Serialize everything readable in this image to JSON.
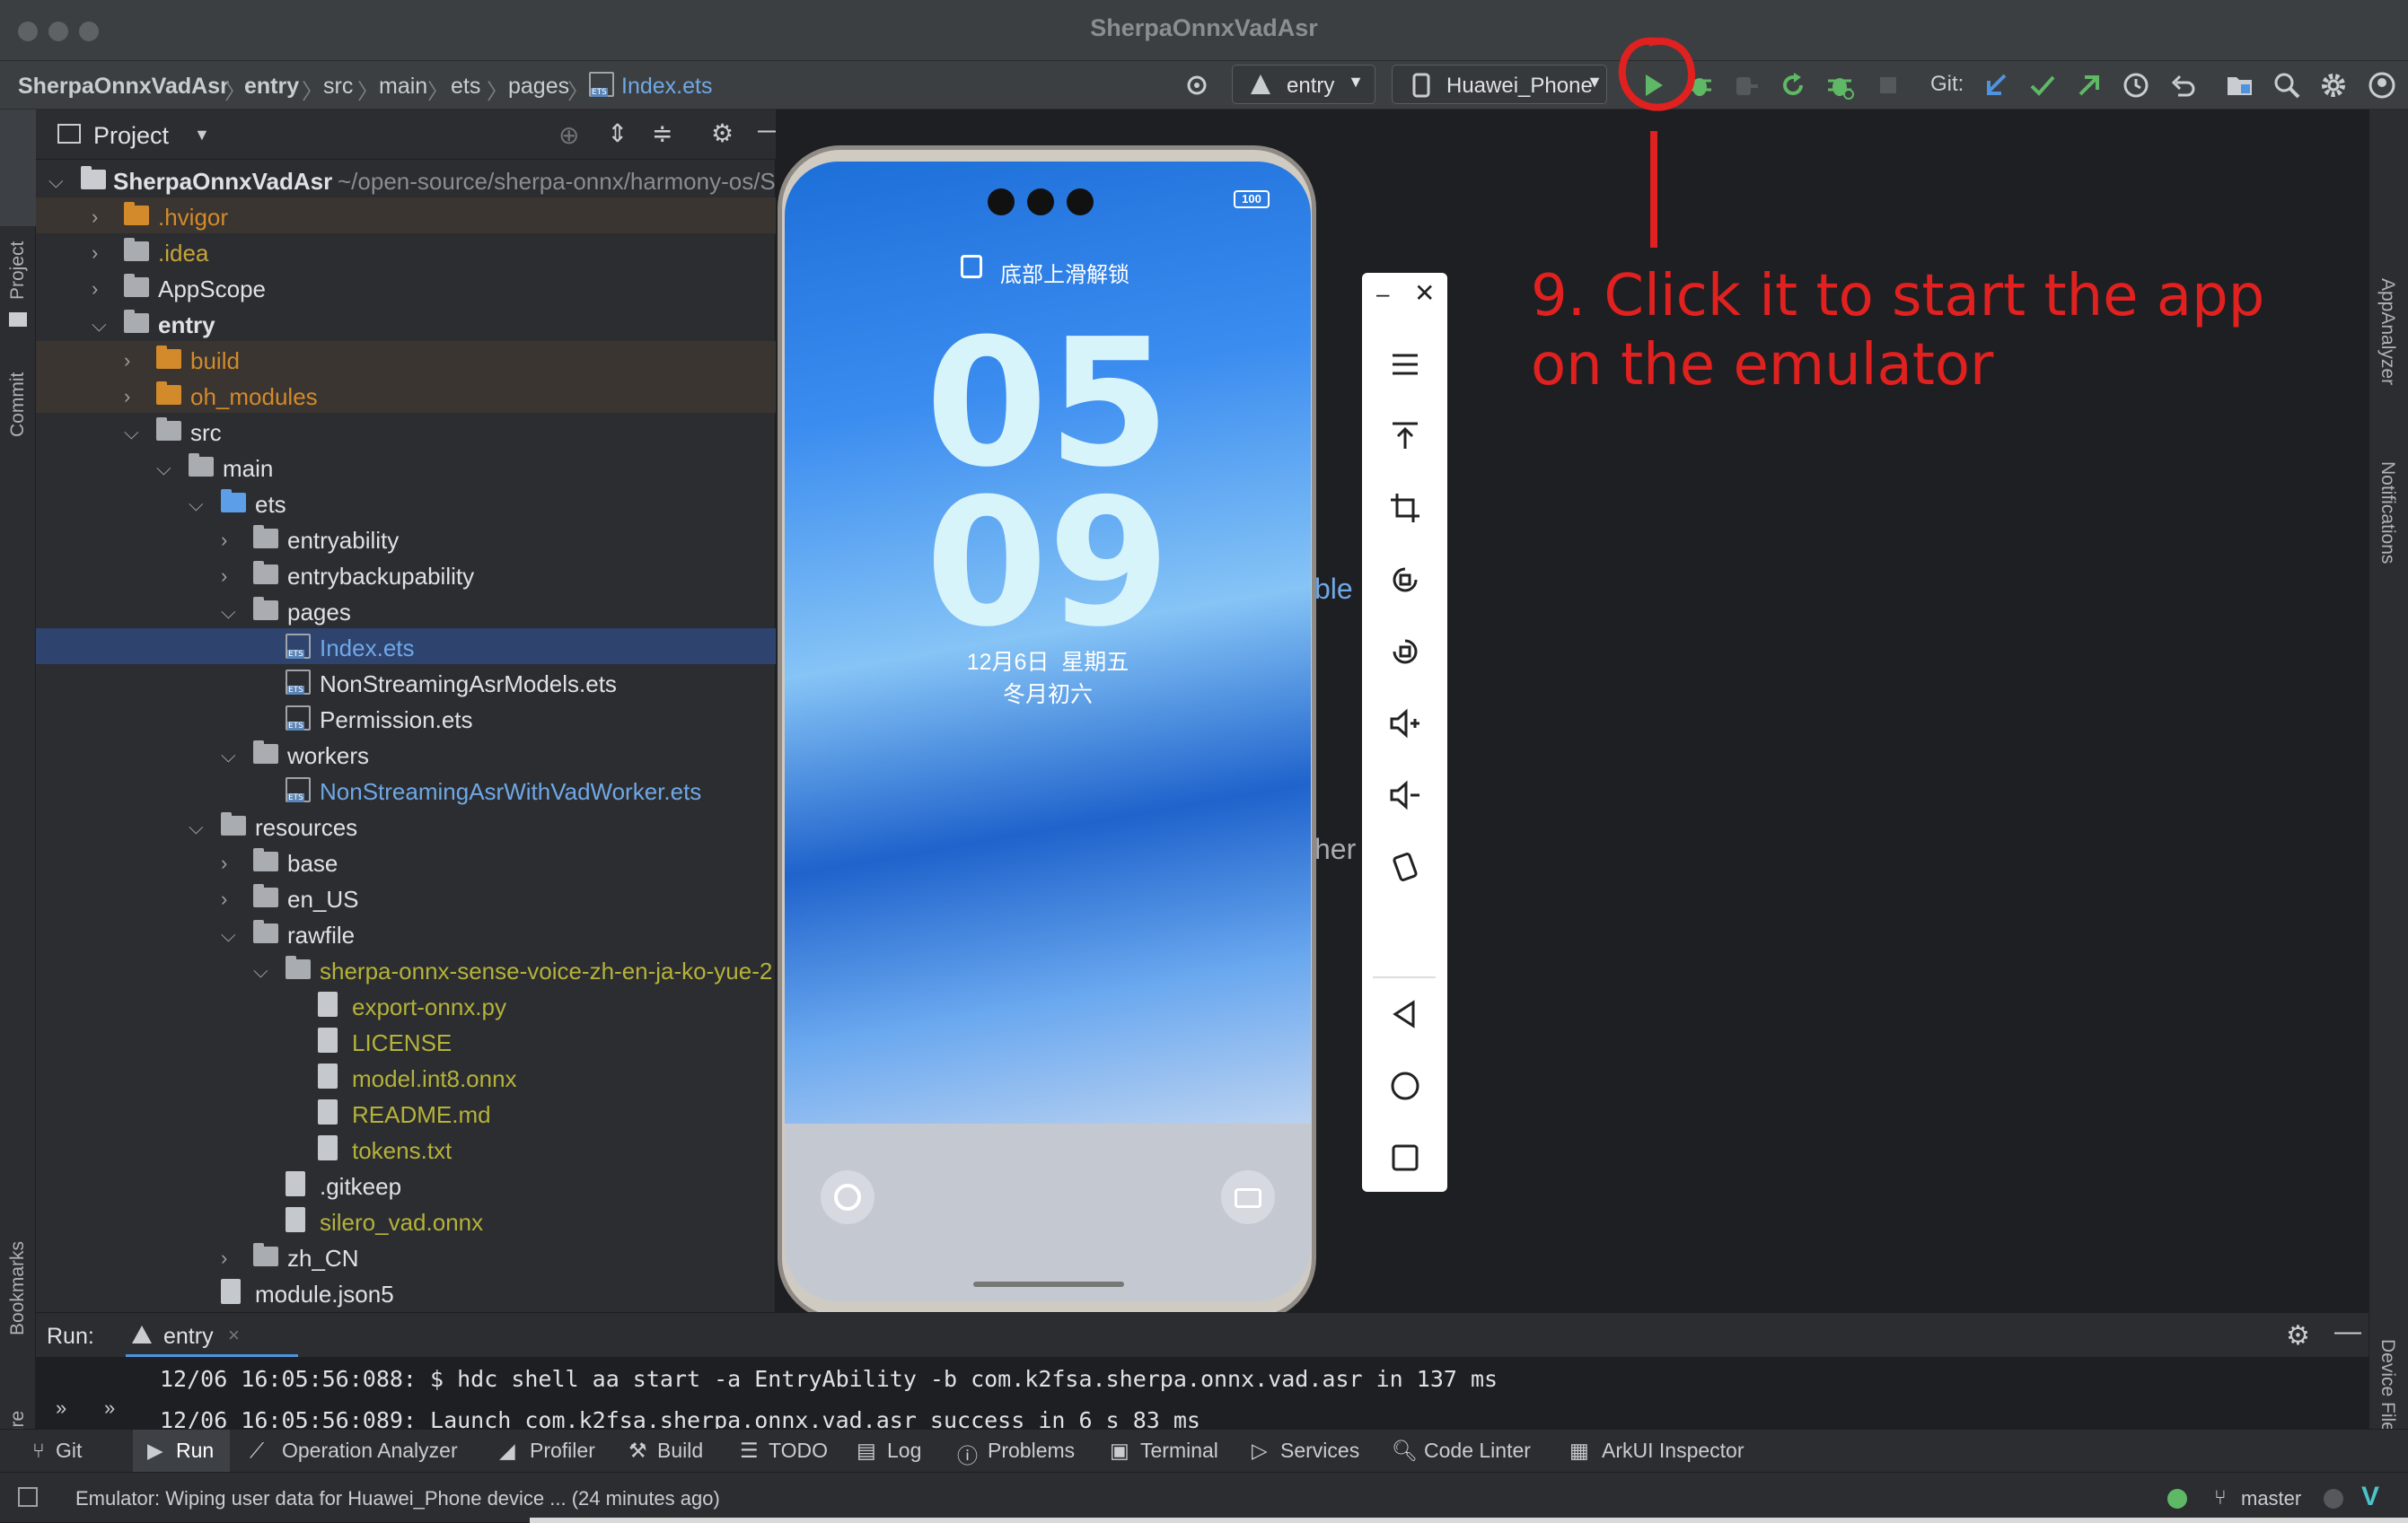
{
  "window": {
    "title": "SherpaOnnxVadAsr"
  },
  "breadcrumb": [
    "SherpaOnnxVadAsr",
    "entry",
    "src",
    "main",
    "ets",
    "pages",
    "Index.ets"
  ],
  "toolbar": {
    "run_config": "entry",
    "device": "Huawei_Phone",
    "git_label": "Git:"
  },
  "project": {
    "title": "Project",
    "root": "SherpaOnnxVadAsr",
    "root_path": "~/open-source/sherpa-onnx/harmony-os/S"
  },
  "tree": [
    {
      "label": ".hvigor",
      "type": "folder",
      "depth": 1,
      "color": "#d38a2b",
      "excluded": true,
      "arrow": ">"
    },
    {
      "label": ".idea",
      "type": "folder",
      "depth": 1,
      "color": "#c8a53a",
      "excluded": false,
      "arrow": ">"
    },
    {
      "label": "AppScope",
      "type": "folder",
      "depth": 1,
      "color": "#dfe1e5",
      "excluded": false,
      "arrow": ">"
    },
    {
      "label": "entry",
      "type": "module",
      "depth": 1,
      "color": "#dfe1e5",
      "bold": true,
      "arrow": "v"
    },
    {
      "label": "build",
      "type": "folder",
      "depth": 2,
      "color": "#d38a2b",
      "excluded": true,
      "arrow": ">"
    },
    {
      "label": "oh_modules",
      "type": "folder",
      "depth": 2,
      "color": "#d38a2b",
      "excluded": true,
      "arrow": ">"
    },
    {
      "label": "src",
      "type": "folder",
      "depth": 2,
      "color": "#dfe1e5",
      "arrow": "v"
    },
    {
      "label": "main",
      "type": "folder",
      "depth": 3,
      "color": "#dfe1e5",
      "arrow": "v"
    },
    {
      "label": "ets",
      "type": "folder",
      "depth": 4,
      "color": "#dfe1e5",
      "arrow": "v",
      "blue": true
    },
    {
      "label": "entryability",
      "type": "folder",
      "depth": 5,
      "color": "#dfe1e5",
      "arrow": ">"
    },
    {
      "label": "entrybackupability",
      "type": "folder",
      "depth": 5,
      "color": "#dfe1e5",
      "arrow": ">"
    },
    {
      "label": "pages",
      "type": "folder",
      "depth": 5,
      "color": "#dfe1e5",
      "arrow": "v"
    },
    {
      "label": "Index.ets",
      "type": "ets",
      "depth": 6,
      "color": "#6fa8e6",
      "selected": true
    },
    {
      "label": "NonStreamingAsrModels.ets",
      "type": "ets",
      "depth": 6,
      "color": "#dfe1e5"
    },
    {
      "label": "Permission.ets",
      "type": "ets",
      "depth": 6,
      "color": "#dfe1e5"
    },
    {
      "label": "workers",
      "type": "folder",
      "depth": 5,
      "color": "#dfe1e5",
      "arrow": "v"
    },
    {
      "label": "NonStreamingAsrWithVadWorker.ets",
      "type": "ets",
      "depth": 6,
      "color": "#6fa8e6"
    },
    {
      "label": "resources",
      "type": "folder",
      "depth": 4,
      "color": "#dfe1e5",
      "arrow": "v"
    },
    {
      "label": "base",
      "type": "folder",
      "depth": 5,
      "color": "#dfe1e5",
      "arrow": ">"
    },
    {
      "label": "en_US",
      "type": "folder",
      "depth": 5,
      "color": "#dfe1e5",
      "arrow": ">"
    },
    {
      "label": "rawfile",
      "type": "folder",
      "depth": 5,
      "color": "#dfe1e5",
      "arrow": "v"
    },
    {
      "label": "sherpa-onnx-sense-voice-zh-en-ja-ko-yue-2",
      "type": "folder",
      "depth": 6,
      "color": "#b5b23a",
      "arrow": "v"
    },
    {
      "label": "export-onnx.py",
      "type": "file",
      "depth": 7,
      "color": "#b5b23a"
    },
    {
      "label": "LICENSE",
      "type": "file",
      "depth": 7,
      "color": "#b5b23a"
    },
    {
      "label": "model.int8.onnx",
      "type": "file",
      "depth": 7,
      "color": "#b5b23a"
    },
    {
      "label": "README.md",
      "type": "file",
      "depth": 7,
      "color": "#b5b23a"
    },
    {
      "label": "tokens.txt",
      "type": "file",
      "depth": 7,
      "color": "#b5b23a"
    },
    {
      "label": ".gitkeep",
      "type": "file",
      "depth": 6,
      "color": "#dfe1e5"
    },
    {
      "label": "silero_vad.onnx",
      "type": "file",
      "depth": 6,
      "color": "#b5b23a"
    },
    {
      "label": "zh_CN",
      "type": "folder",
      "depth": 5,
      "color": "#dfe1e5",
      "arrow": ">"
    },
    {
      "label": "module.json5",
      "type": "file",
      "depth": 4,
      "color": "#dfe1e5"
    }
  ],
  "phone": {
    "lock_hint": "底部上滑解锁",
    "hour": "05",
    "minute": "09",
    "date": "12月6日  星期五",
    "lunar": "冬月初六",
    "battery": "100"
  },
  "editor_fragments": [
    "ble",
    "her"
  ],
  "annotation": {
    "line1": "9. Click it to start the app",
    "line2": "on the emulator",
    "color": "#e0211f"
  },
  "run": {
    "label": "Run:",
    "tab": "entry",
    "lines": [
      "12/06 16:05:56:088: $ hdc shell aa start -a EntryAbility -b com.k2fsa.sherpa.onnx.vad.asr in 137 ms",
      "12/06 16:05:56:089: Launch com.k2fsa.sherpa.onnx.vad.asr success in 6 s 83 ms"
    ]
  },
  "bottom_tabs": [
    "Git",
    "Run",
    "Operation Analyzer",
    "Profiler",
    "Build",
    "TODO",
    "Log",
    "Problems",
    "Terminal",
    "Services",
    "Code Linter",
    "ArkUI Inspector"
  ],
  "status": {
    "message": "Emulator: Wiping user data for Huawei_Phone device ... (24 minutes ago)",
    "branch": "master"
  },
  "left_tools": [
    "Project",
    "Commit",
    "Bookmarks",
    "Structure"
  ],
  "right_tools": [
    "AppAnalyzer",
    "Notifications",
    "Device File Browser"
  ]
}
